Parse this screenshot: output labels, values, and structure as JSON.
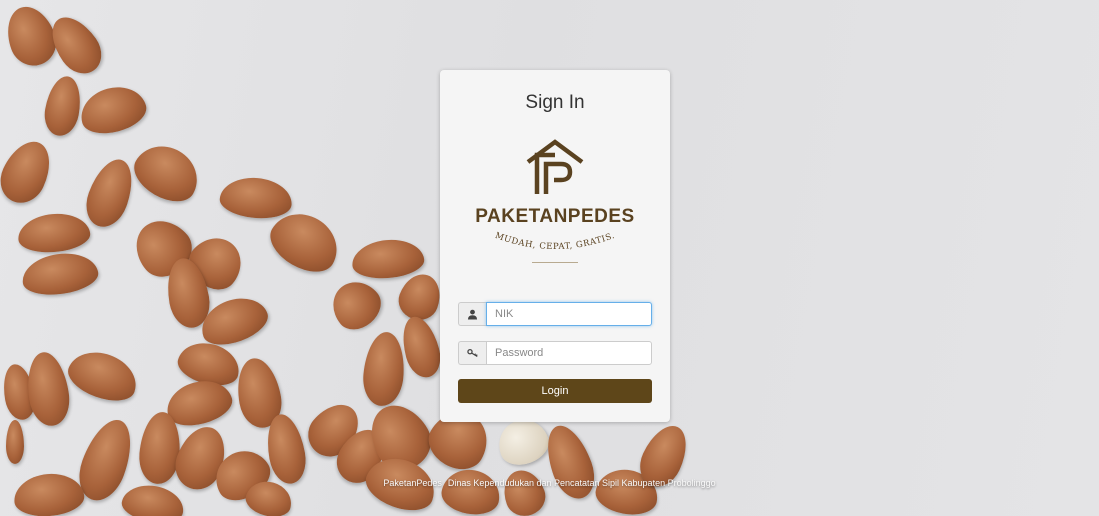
{
  "login": {
    "title": "Sign In",
    "brand_name": "PAKETANPEDES",
    "tagline": "MUDAH, CEPAT, GRATIS.",
    "nik_placeholder": "NIK",
    "password_placeholder": "Password",
    "login_label": "Login",
    "user_icon": "user-icon",
    "key_icon": "key-icon"
  },
  "footer": {
    "app_name": "PaketanPedes",
    "org_name": "Dinas Kependudukan dan Pencatatan Sipil Kabupaten Probolinggo"
  },
  "colors": {
    "brand": "#5a4220",
    "button": "#5e4619",
    "card": "#f5f5f5",
    "focus": "#66afe9"
  }
}
